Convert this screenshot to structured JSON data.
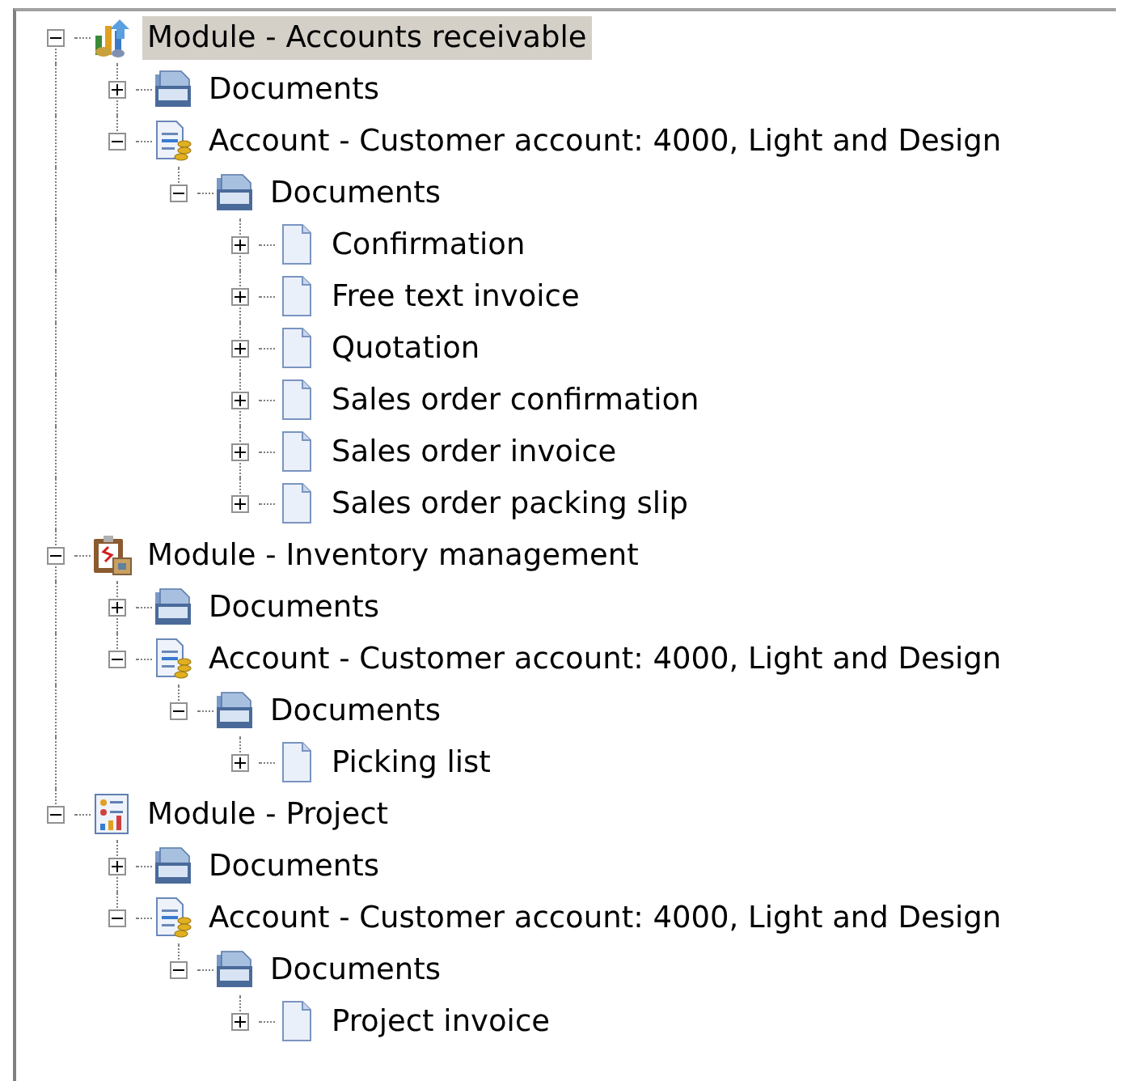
{
  "tree": [
    {
      "label": "Module - Accounts receivable",
      "kind": "module-chart",
      "selected": true,
      "expanded": true,
      "children": [
        {
          "label": "Documents",
          "kind": "folder",
          "selected": false,
          "expanded": false
        },
        {
          "label": "Account - Customer account: 4000, Light and Design",
          "kind": "account",
          "selected": false,
          "expanded": true,
          "children": [
            {
              "label": "Documents",
              "kind": "folder",
              "selected": false,
              "expanded": true,
              "children": [
                {
                  "label": "Confirmation",
                  "kind": "page",
                  "selected": false,
                  "expanded": false
                },
                {
                  "label": "Free text invoice",
                  "kind": "page",
                  "selected": false,
                  "expanded": false
                },
                {
                  "label": "Quotation",
                  "kind": "page",
                  "selected": false,
                  "expanded": false
                },
                {
                  "label": "Sales order confirmation",
                  "kind": "page",
                  "selected": false,
                  "expanded": false
                },
                {
                  "label": "Sales order invoice",
                  "kind": "page",
                  "selected": false,
                  "expanded": false
                },
                {
                  "label": "Sales order packing slip",
                  "kind": "page",
                  "selected": false,
                  "expanded": false
                }
              ]
            }
          ]
        }
      ]
    },
    {
      "label": "Module - Inventory management",
      "kind": "module-clipboard",
      "selected": false,
      "expanded": true,
      "children": [
        {
          "label": "Documents",
          "kind": "folder",
          "selected": false,
          "expanded": false
        },
        {
          "label": "Account - Customer account: 4000, Light and Design",
          "kind": "account",
          "selected": false,
          "expanded": true,
          "children": [
            {
              "label": "Documents",
              "kind": "folder",
              "selected": false,
              "expanded": true,
              "children": [
                {
                  "label": "Picking list",
                  "kind": "page",
                  "selected": false,
                  "expanded": false
                }
              ]
            }
          ]
        }
      ]
    },
    {
      "label": "Module - Project",
      "kind": "module-report",
      "selected": false,
      "expanded": true,
      "children": [
        {
          "label": "Documents",
          "kind": "folder",
          "selected": false,
          "expanded": false
        },
        {
          "label": "Account - Customer account: 4000, Light and Design",
          "kind": "account",
          "selected": false,
          "expanded": true,
          "children": [
            {
              "label": "Documents",
              "kind": "folder",
              "selected": false,
              "expanded": true,
              "children": [
                {
                  "label": "Project invoice",
                  "kind": "page",
                  "selected": false,
                  "expanded": false
                }
              ]
            }
          ]
        }
      ]
    }
  ]
}
